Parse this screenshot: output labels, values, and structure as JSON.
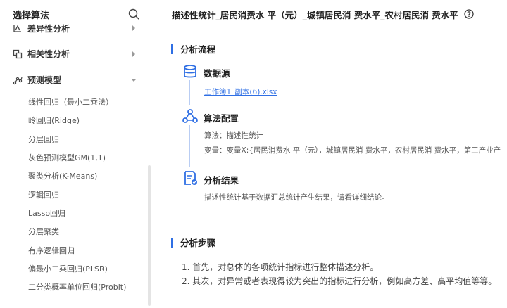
{
  "sidebar": {
    "title": "选择算法",
    "groups": [
      {
        "label": "差异性分析"
      },
      {
        "label": "相关性分析"
      },
      {
        "label": "预测模型"
      }
    ],
    "items": [
      "线性回归（最小二乘法）",
      "岭回归(Ridge)",
      "分层回归",
      "灰色预测模型GM(1,1)",
      "聚类分析(K-Means)",
      "逻辑回归",
      "Lasso回归",
      "分层聚类",
      "有序逻辑回归",
      "偏最小二乘回归(PLSR)",
      "二分类概率单位回归(Probit)"
    ]
  },
  "main": {
    "title": "描述性统计_居民消费水 平（元）_城镇居民消 费水平_农村居民消 费水平",
    "flow": {
      "heading": "分析流程",
      "data_source": {
        "title": "数据源",
        "file": "工作簿1_副本(6).xlsx"
      },
      "algorithm": {
        "title": "算法配置",
        "algo_line": "算法：描述性统计",
        "var_line": "变量：变量X:{居民消费水 平（元），城镇居民消 费水平，农村居民消 费水平，第三产业产"
      },
      "result": {
        "title": "分析结果",
        "text": "描述性统计基于数据汇总统计产生结果，请看详细结论。"
      }
    },
    "steps": {
      "heading": "分析步骤",
      "items": [
        "1. 首先，对总体的各项统计指标进行整体描述分析。",
        "2. 其次，对异常或者表现得较为突出的指标进行分析，例如高方差、高平均值等等。"
      ]
    }
  },
  "colors": {
    "accent": "#2f6fe4",
    "line": "#b9cdf3"
  }
}
